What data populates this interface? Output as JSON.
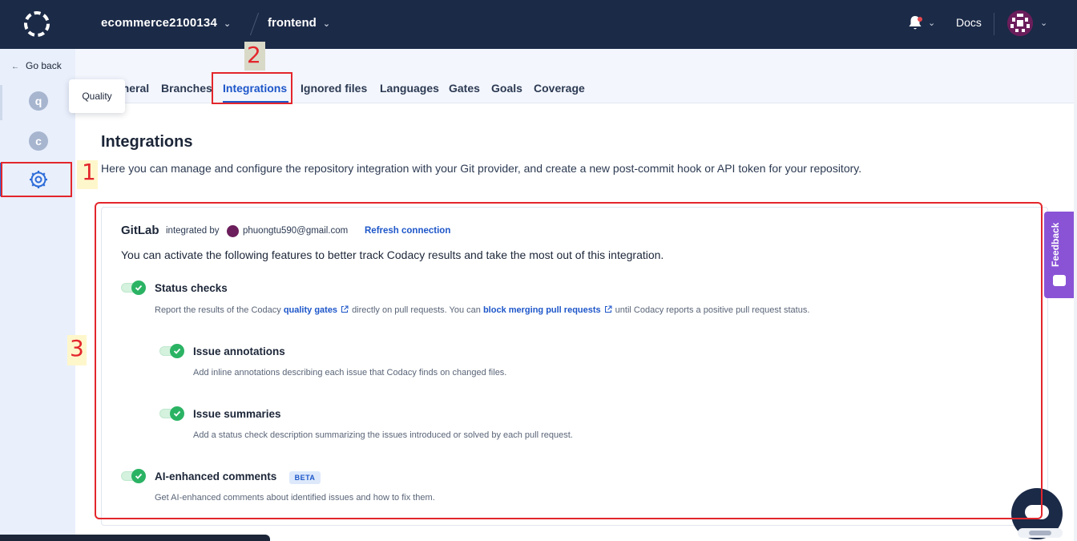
{
  "topbar": {
    "org": "ecommerce2100134",
    "repo": "frontend",
    "docs": "Docs"
  },
  "sidebar": {
    "go_back": "Go back",
    "items": [
      {
        "letter": "q",
        "tooltip": "Quality"
      },
      {
        "letter": "c"
      }
    ]
  },
  "tabs": [
    "General",
    "Branches",
    "Integrations",
    "Ignored files",
    "Languages",
    "Gates",
    "Goals",
    "Coverage"
  ],
  "active_tab": "Integrations",
  "page": {
    "title": "Integrations",
    "description": "Here you can manage and configure the repository integration with your Git provider, and create a new post-commit hook or API token for your repository."
  },
  "gitlab": {
    "title": "GitLab",
    "integrated_by": "integrated by",
    "email": "phuongtu590@gmail.com",
    "refresh": "Refresh connection",
    "intro": "You can activate the following features to better track Codacy results and take the most out of this integration.",
    "features": {
      "status_checks": {
        "title": "Status checks",
        "desc_part1": "Report the results of the Codacy",
        "link1": "quality gates",
        "desc_part2": "directly on pull requests. You can",
        "link2": "block merging pull requests",
        "desc_part3": "until Codacy reports a positive pull request status.",
        "enabled": true
      },
      "issue_annotations": {
        "title": "Issue annotations",
        "desc": "Add inline annotations describing each issue that Codacy finds on changed files.",
        "enabled": true
      },
      "issue_summaries": {
        "title": "Issue summaries",
        "desc": "Add a status check description summarizing the issues introduced or solved by each pull request.",
        "enabled": true
      },
      "ai_comments": {
        "title": "AI-enhanced comments",
        "badge": "BETA",
        "desc": "Get AI-enhanced comments about identified issues and how to fix them.",
        "enabled": true
      }
    }
  },
  "feedback": "Feedback",
  "annotations": [
    "1",
    "2",
    "3"
  ],
  "colors": {
    "topbar": "#1b2a47",
    "accent": "#1d56c9",
    "toggle_on": "#2bb364",
    "annotation": "#e3262c",
    "feedback": "#8a53d6"
  }
}
